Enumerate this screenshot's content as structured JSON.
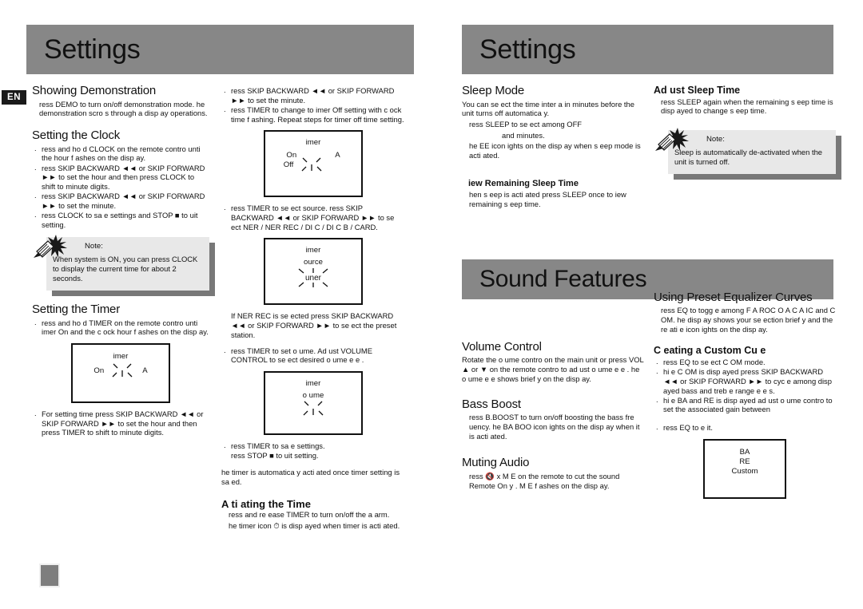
{
  "document": {
    "language_tab": "EN",
    "page_left": {
      "banner_title": "Settings"
    },
    "page_right": {
      "banner_title": "Settings",
      "banner_title_2": "Sound Features"
    }
  },
  "column1": {
    "heading_demo": "Showing Demonstration",
    "demo_body": "ress DEMO to turn on/off demonstration mode. he demonstration scro s through a  disp ay operations.",
    "heading_clock": "Setting the Clock",
    "clock_steps": [
      "ress and ho d CLOCK on the remote contro  unti  the hour f ashes on the disp ay.",
      "ress SKIP BACKWARD  ◄◄  or SKIP FORWARD  ►►  to set the hour and then press CLOCK to shift to minute digits.",
      "ress SKIP BACKWARD  ◄◄  or SKIP FORWARD  ►►  to set the minute.",
      "ress CLOCK  to sa e settings and STOP ■ to  uit setting."
    ],
    "note_label": "Note:",
    "note_text": "When system is ON, you can press  CLOCK to display the current time for about 2 seconds.",
    "heading_timer": "Setting the Timer",
    "timer_step_1": "ress and ho d TIMER on the remote contro  unti   imer On and the c ock hour f ashes on the disp ay.",
    "lcd_timer": {
      "line1": "imer",
      "left": "On",
      "right": "A",
      "digit": "I"
    },
    "timer_step_2": "For setting time  press SKIP BACKWARD  ◄◄ or SKIP FORWARD  ►► to set the hour and then press TIMER to shift to minute digits."
  },
  "column2": {
    "steps_top": [
      "ress  SKIP BACKWARD   ◄◄  or SKIP FORWARD   ►►  to set the minute.",
      "ress TIMER to change to  imer Off setting with c ock time f ashing. Repeat steps          for timer off time setting."
    ],
    "lcd_timer_onoff": {
      "line1": "imer",
      "left_on": "On",
      "right": "A",
      "left_off": "Off",
      "digit": "I"
    },
    "step_source": "ress TIMER to se ect source.    ress SKIP BACKWARD   ◄◄  or SKIP FORWARD  ►►  to se ect     NER /    NER REC / DI  C /   DI  C       B  / CARD.",
    "lcd_source": {
      "line1": "imer",
      "line2": "ource",
      "line3": "uner",
      "digit": "I"
    },
    "step_tuner_rec": "If     NER REC is se ected  press SKIP BACKWARD   ◄◄  or SKIP FORWARD  ►► to se ect the preset station.",
    "step_volume": "ress TIMER to set  o ume.  Ad ust VOLUME CONTROL to se ect desired  o ume  e e .",
    "lcd_volume": {
      "line1": "imer",
      "line2": "o ume",
      "digit": "I"
    },
    "step_save": "ress TIMER  to sa e settings.",
    "step_save_2": "ress STOP  ■   to  uit setting.",
    "auto_note": "he timer is automatica  y acti ated once timer setting is sa ed.",
    "heading_activate": "A ti ating the Time",
    "activate_body_1": "ress and re ease TIMER to turn on/off the a arm.",
    "activate_body_2": "he timer icon  ⏱   is disp ayed when timer is acti ated."
  },
  "column3": {
    "heading_sleep": "Sleep Mode",
    "sleep_body_1": "You can se ect the time inter a  in minutes before the unit turns off automatica  y.",
    "sleep_body_2": "ress SLEEP to se ect among OFF",
    "sleep_body_3": "and      minutes.",
    "sleep_body_4": "he   EE  icon  ights on the disp ay when s eep mode is acti ated.",
    "heading_view": "iew Remaining Sleep Time",
    "view_body": "hen s eep is acti ated  press SLEEP once to  iew remaining s eep time.",
    "heading_volume": "Volume Control",
    "volume_body": "Rotate the  o ume contro  on the main unit or press VOL ▲ or ▼  on the remote contro  to ad ust  o ume  e e .  he  o ume  e e  shows brief y on the disp ay.",
    "heading_bass": "Bass Boost",
    "bass_body": "ress B.BOOST  to turn on/off boosting the bass fre uency.  he BA    BOO   icon  ights on the disp ay when it is acti ated.",
    "heading_mute": "Muting Audio",
    "mute_body": "ress  🔇 x  M    E on the remote to cut the sound Remote On y . M    E f ashes on the disp ay."
  },
  "column4": {
    "heading_adjust": "Ad ust Sleep Time",
    "adjust_body": "ress SLEEP again when the remaining s eep time is disp ayed to change s eep time.",
    "note_label": "Note:",
    "note_text": "Sleep is automatically de-activated when the unit is turned off.",
    "heading_eq": "Using Preset Equalizer Curves",
    "eq_body": "ress EQ to togg e among F A   ROC     O    A   C A   IC and C    OM.   he disp ay shows your se ection brief y and the re ati e icon  ights on the disp ay.",
    "heading_custom": "C eating a Custom Cu  e",
    "custom_steps": [
      "ress EQ to se ect C     OM mode.",
      "hi e C    OM is disp ayed  press SKIP BACKWARD   ◄◄  or SKIP FORWARD  ►►  to cyc e  among disp ayed bass and treb e range  e e s.",
      "hi e BA   and   RE is disp ayed  ad ust  o ume contro  to set the associated gain between",
      "ress EQ to e it."
    ],
    "lcd_eq": {
      "line1": "BA",
      "line2": "RE",
      "line3": "Custom"
    }
  },
  "colors": {
    "banner_gray": "#878787",
    "note_gray": "#e8e8e8",
    "note_shadow": "#787878",
    "tab_black": "#1a1a1a",
    "page_block_gray": "#7e7e7e"
  }
}
